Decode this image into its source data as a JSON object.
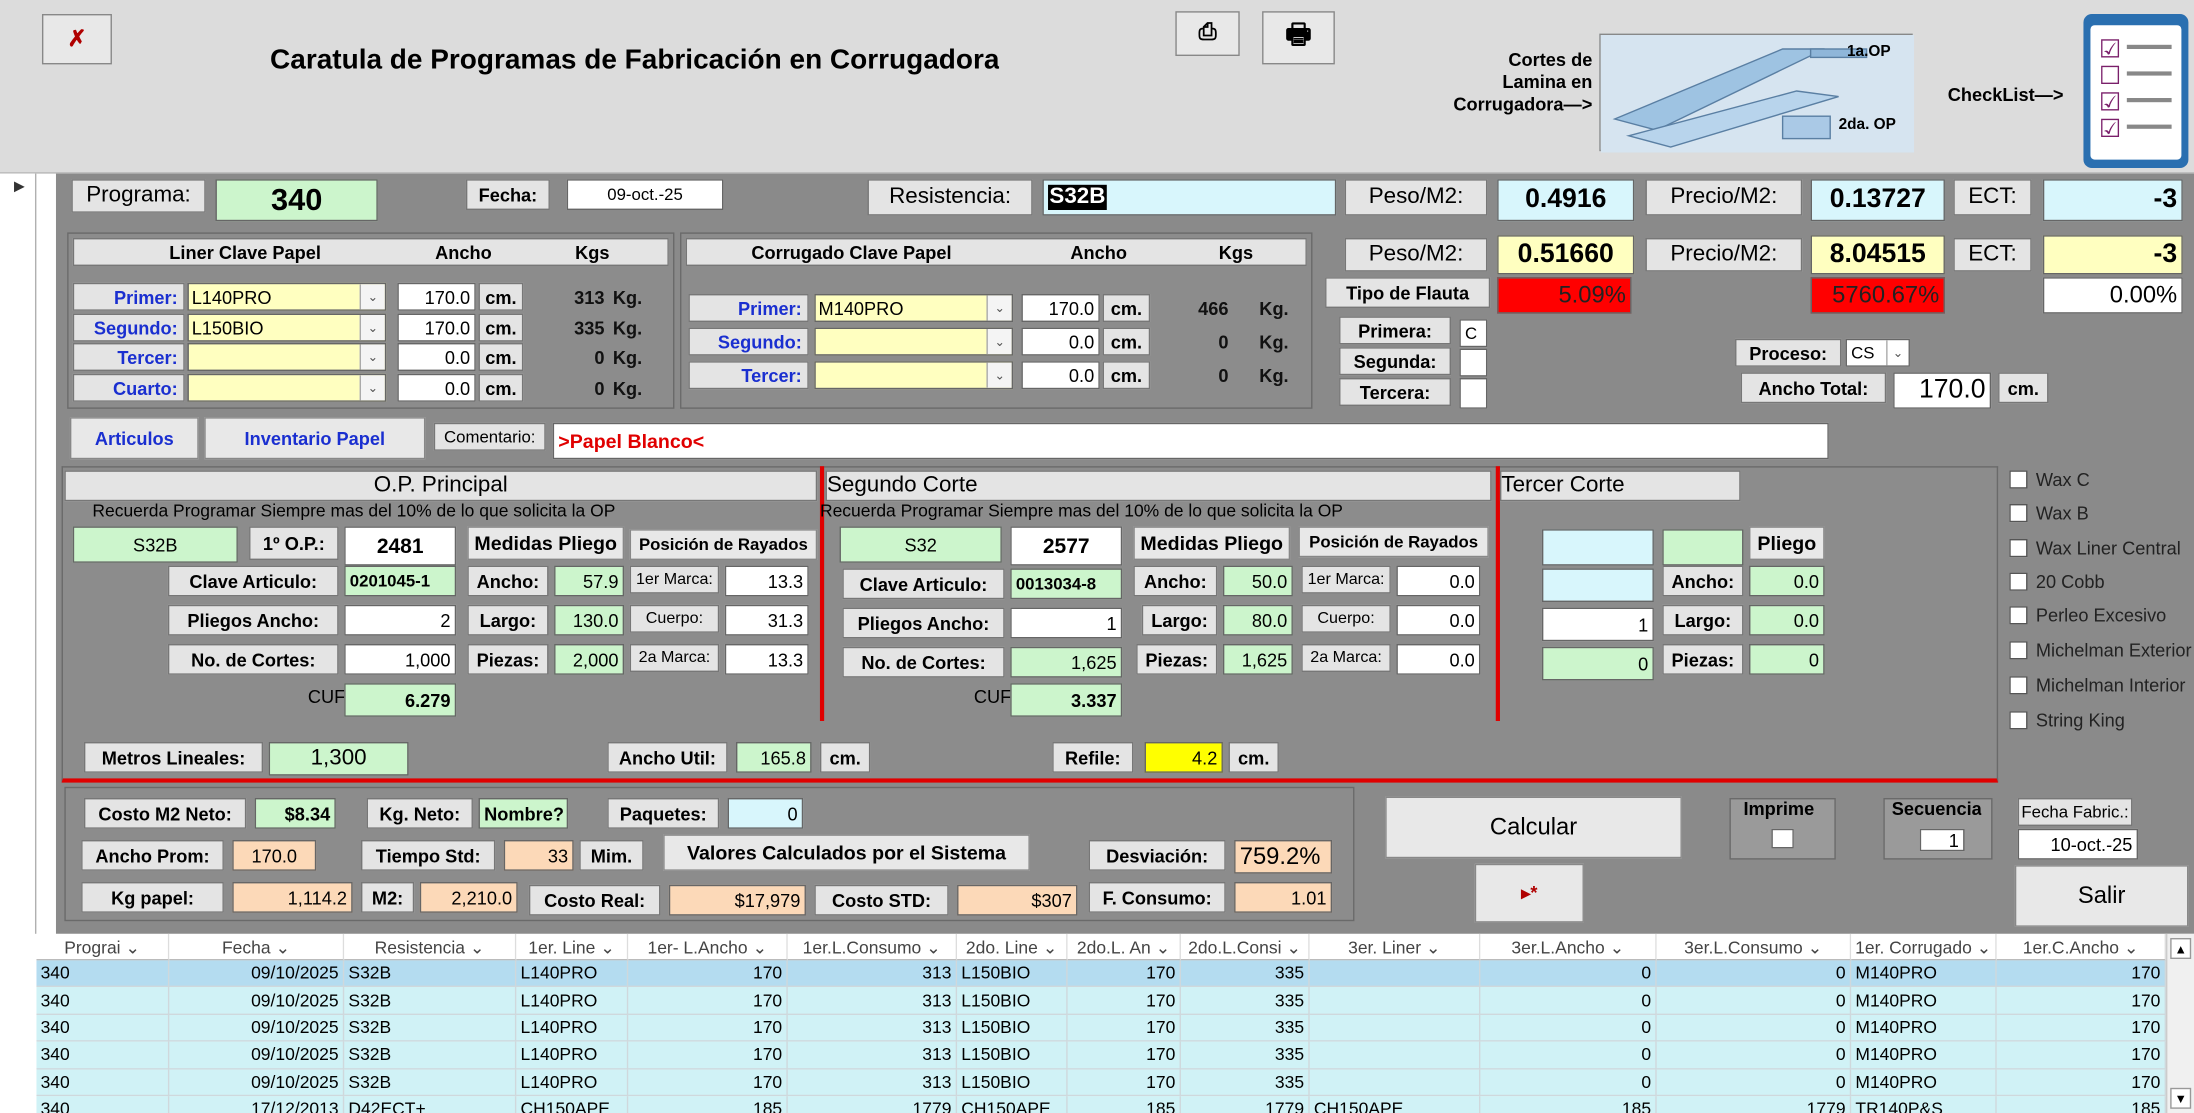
{
  "header": {
    "title": "Caratula de Programas de Fabricación en Corrugadora",
    "cortes_label": "Cortes de\nLamina en\nCorrugadora—>",
    "pic_op1": "1a.OP",
    "pic_op2": "2da. OP",
    "checklist_label": "CheckList—>"
  },
  "top": {
    "programa_label": "Programa:",
    "programa": "340",
    "fecha_label": "Fecha:",
    "fecha": "09-oct.-25",
    "resistencia_label": "Resistencia:",
    "resistencia": "S32B",
    "peso_label": "Peso/M2:",
    "peso": "0.4916",
    "precio_label": "Precio/M2:",
    "precio": "0.13727",
    "ect_label": "ECT:",
    "ect": "-3"
  },
  "liner": {
    "header": "Liner  Clave Papel",
    "ancho_h": "Ancho",
    "kgs_h": "Kgs",
    "cm": "cm.",
    "kg": "Kg.",
    "rows": [
      {
        "label": "Primer:",
        "clave": "L140PRO",
        "ancho": "170.0",
        "kgs": "313"
      },
      {
        "label": "Segundo:",
        "clave": "L150BIO",
        "ancho": "170.0",
        "kgs": "335"
      },
      {
        "label": "Tercer:",
        "clave": "",
        "ancho": "0.0",
        "kgs": "0"
      },
      {
        "label": "Cuarto:",
        "clave": "",
        "ancho": "0.0",
        "kgs": "0"
      }
    ]
  },
  "corrugado": {
    "header": "Corrugado  Clave Papel",
    "ancho_h": "Ancho",
    "kgs_h": "Kgs",
    "rows": [
      {
        "label": "Primer:",
        "clave": "M140PRO",
        "ancho": "170.0",
        "kgs": "466"
      },
      {
        "label": "Segundo:",
        "clave": "",
        "ancho": "0.0",
        "kgs": "0"
      },
      {
        "label": "Tercer:",
        "clave": "",
        "ancho": "0.0",
        "kgs": "0"
      }
    ]
  },
  "right": {
    "peso_label": "Peso/M2:",
    "peso": "0.51660",
    "precio_label": "Precio/M2:",
    "precio": "8.04515",
    "ect_label": "ECT:",
    "ect": "-3",
    "tipo_flauta": "Tipo de Flauta",
    "pct1": "5.09%",
    "pct2": "5760.67%",
    "pct3": "0.00%",
    "primera": "Primera:",
    "primera_val": "C",
    "segunda": "Segunda:",
    "tercera": "Tercera:",
    "proceso_label": "Proceso:",
    "proceso": "CS",
    "ancho_total_label": "Ancho Total:",
    "ancho_total": "170.0",
    "cm": "cm."
  },
  "buttons": {
    "articulos": "Articulos",
    "inventario": "Inventario Papel",
    "comentario_label": "Comentario:",
    "comentario": ">Papel Blanco<",
    "calcular": "Calcular",
    "salir": "Salir",
    "nav": "▸*"
  },
  "op": {
    "title": "O.P. Principal",
    "recuerda": "Recuerda Programar Siempre mas del 10%  de lo que solicita la OP",
    "res": "S32B",
    "op_label": "1º O.P.:",
    "op": "2481",
    "medidas": "Medidas Pliego",
    "posicion": "Posición de Rayados",
    "clave_label": "Clave Articulo:",
    "clave": "0201045-1",
    "ancho_label": "Ancho:",
    "ancho": "57.9",
    "marca1_label": "1er Marca:",
    "marca1": "13.3",
    "pliegos_label": "Pliegos Ancho:",
    "pliegos": "2",
    "largo_label": "Largo:",
    "largo": "130.0",
    "cuerpo_label": "Cuerpo:",
    "cuerpo": "31.3",
    "cortes_label": "No. de Cortes:",
    "cortes": "1,000",
    "piezas_label": "Piezas:",
    "piezas": "2,000",
    "marca2_label": "2a Marca:",
    "marca2": "13.3",
    "cuf_label": "CUF",
    "cuf": "6.279"
  },
  "op2": {
    "title": "Segundo Corte",
    "recuerda": "Recuerda Programar Siempre mas del 10%  de lo que solicita la OP",
    "res": "S32",
    "op": "2577",
    "medidas": "Medidas Pliego",
    "posicion": "Posición de Rayados",
    "clave_label": "Clave Articulo:",
    "clave": "0013034-8",
    "ancho_label": "Ancho:",
    "ancho": "50.0",
    "marca1_label": "1er Marca:",
    "marca1": "0.0",
    "pliegos_label": "Pliegos Ancho:",
    "pliegos": "1",
    "largo_label": "Largo:",
    "largo": "80.0",
    "cuerpo_label": "Cuerpo:",
    "cuerpo": "0.0",
    "cortes_label": "No. de Cortes:",
    "cortes": "1,625",
    "piezas_label": "Piezas:",
    "piezas": "1,625",
    "marca2_label": "2a Marca:",
    "marca2": "0.0",
    "cuf_label": "CUF",
    "cuf": "3.337"
  },
  "op3": {
    "title": "Tercer Corte",
    "pliego": "Pliego",
    "ancho_label": "Ancho:",
    "ancho": "0.0",
    "pliegos": "1",
    "largo_label": "Largo:",
    "largo": "0.0",
    "cortes": "0",
    "piezas_label": "Piezas:",
    "piezas": "0"
  },
  "metros": {
    "metros_label": "Metros Lineales:",
    "metros": "1,300",
    "util_label": "Ancho Util:",
    "util": "165.8",
    "cm": "cm.",
    "refile_label": "Refile:",
    "refile": "4.2"
  },
  "costos": {
    "costo_label": "Costo M2 Neto:",
    "costo": "$8.34",
    "kgneto_label": "Kg. Neto:",
    "kgneto": "Nombre?",
    "paquetes_label": "Paquetes:",
    "paquetes": "0",
    "anchoprom_label": "Ancho Prom:",
    "anchoprom": "170.0",
    "tiempo_label": "Tiempo Std:",
    "tiempo": "33",
    "mim": "Mim.",
    "valores": "Valores Calculados por el Sistema",
    "desv_label": "Desviación:",
    "desv": "759.2%",
    "kgpapel_label": "Kg papel:",
    "kgpapel": "1,114.2",
    "m2_label": "M2:",
    "m2": "2,210.0",
    "costoreal_label": "Costo Real:",
    "costoreal": "$17,979",
    "costostd_label": "Costo STD:",
    "costostd": "$307",
    "fconsumo_label": "F. Consumo:",
    "fconsumo": "1.01"
  },
  "misc": {
    "imprime": "Imprime",
    "secuencia": "Secuencia",
    "secuencia_val": "1",
    "fecha_fabric_label": "Fecha Fabric.:",
    "fecha_fabric": "10-oct.-25"
  },
  "checks": [
    "Wax C",
    "Wax B",
    "Wax Liner Central",
    "20 Cobb",
    "Perleo Excesivo",
    "Michelman Exterior",
    "Michelman Interior",
    "String King"
  ],
  "table": {
    "headers": [
      "Prograi ⌄",
      "Fecha  ⌄",
      "Resistencia  ⌄",
      "1er. Line ⌄",
      "1er- L.Ancho  ⌄",
      "1er.L.Consumo ⌄",
      "2do. Line ⌄",
      "2do.L. An ⌄",
      "2do.L.Consi ⌄",
      "3er. Liner  ⌄",
      "3er.L.Ancho  ⌄",
      "3er.L.Consumo ⌄",
      "1er. Corrugado ⌄",
      "1er.C.Ancho ⌄"
    ],
    "rows": [
      [
        "340",
        "09/10/2025",
        "S32B",
        "L140PRO",
        "170",
        "313",
        "L150BIO",
        "170",
        "335",
        "",
        "0",
        "0",
        "M140PRO",
        "170"
      ],
      [
        "340",
        "09/10/2025",
        "S32B",
        "L140PRO",
        "170",
        "313",
        "L150BIO",
        "170",
        "335",
        "",
        "0",
        "0",
        "M140PRO",
        "170"
      ],
      [
        "340",
        "09/10/2025",
        "S32B",
        "L140PRO",
        "170",
        "313",
        "L150BIO",
        "170",
        "335",
        "",
        "0",
        "0",
        "M140PRO",
        "170"
      ],
      [
        "340",
        "09/10/2025",
        "S32B",
        "L140PRO",
        "170",
        "313",
        "L150BIO",
        "170",
        "335",
        "",
        "0",
        "0",
        "M140PRO",
        "170"
      ],
      [
        "340",
        "09/10/2025",
        "S32B",
        "L140PRO",
        "170",
        "313",
        "L150BIO",
        "170",
        "335",
        "",
        "0",
        "0",
        "M140PRO",
        "170"
      ],
      [
        "340",
        "17/12/2013",
        "D42ECT+",
        "CH150APE",
        "185",
        "1779",
        "CH150APE",
        "185",
        "1779",
        "CH150APE",
        "185",
        "1779",
        "TR140P&S",
        "185"
      ]
    ]
  }
}
